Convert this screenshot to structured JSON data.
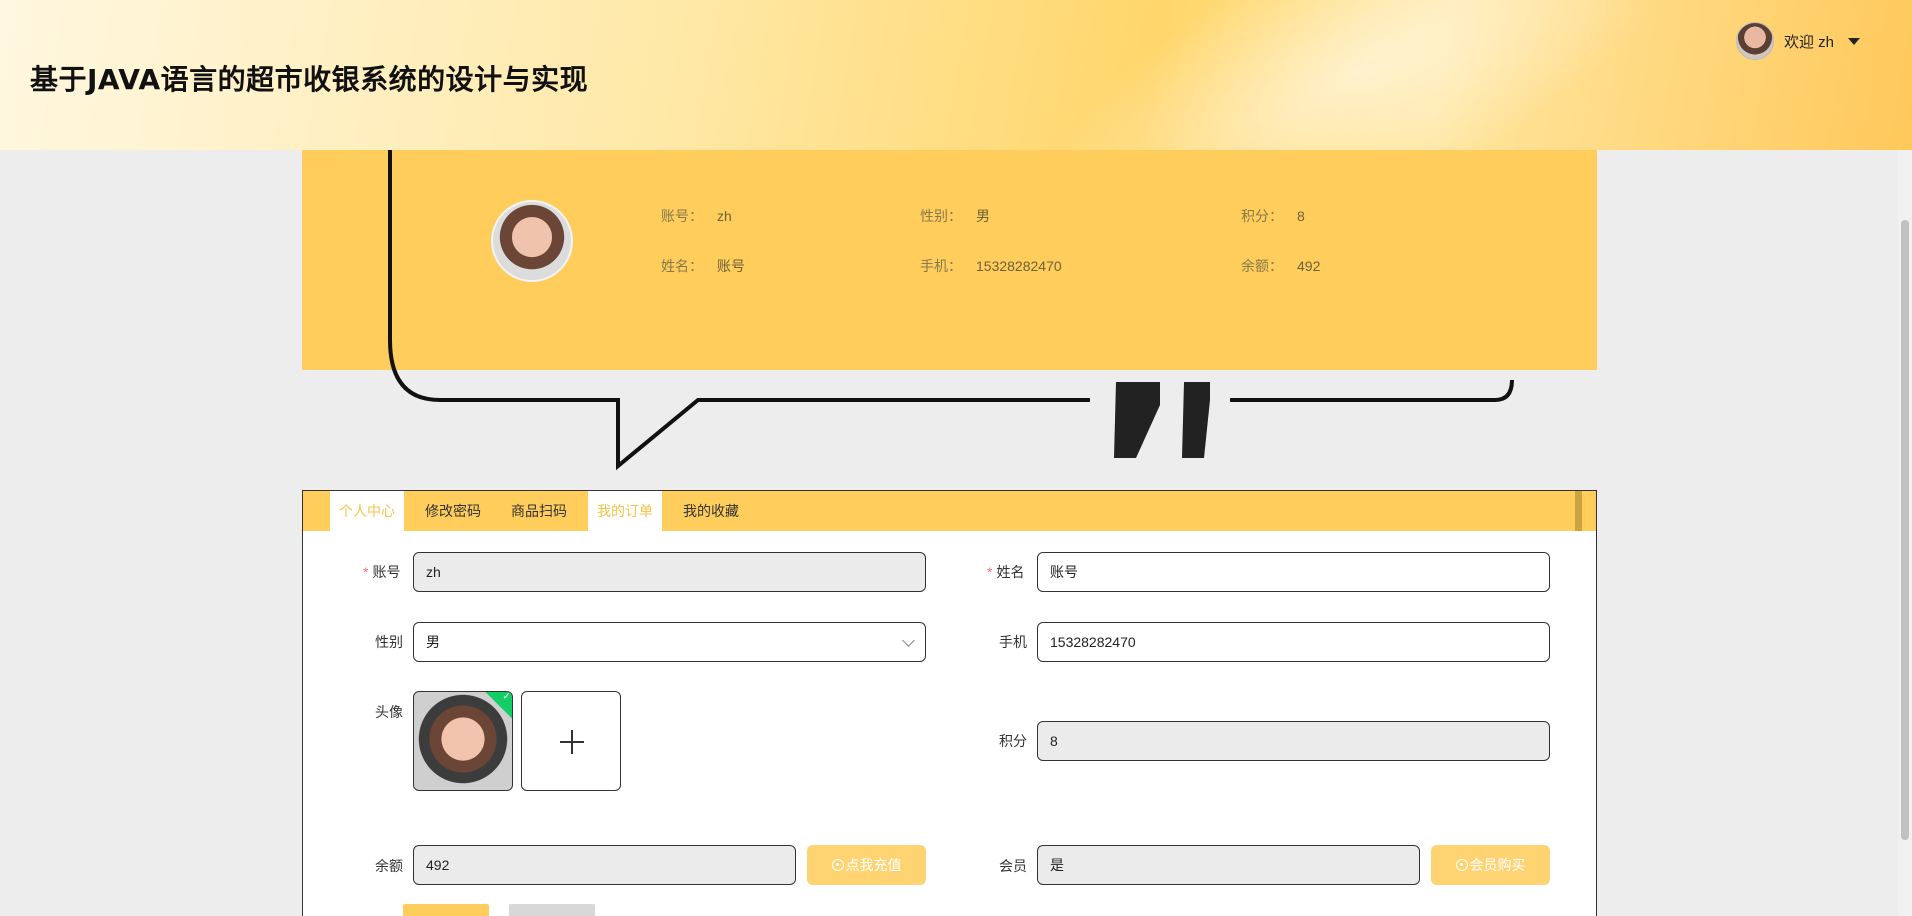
{
  "header": {
    "title": "基于JAVA语言的超市收银系统的设计与实现",
    "welcome": "欢迎 zh",
    "avatar_icon": "user-avatar"
  },
  "profile_card": {
    "account_label": "账号：",
    "account_value": "zh",
    "gender_label": "性别：",
    "gender_value": "男",
    "points_label": "积分：",
    "points_value": "8",
    "name_label": "姓名：",
    "name_value": "账号",
    "phone_label": "手机：",
    "phone_value": "15328282470",
    "balance_label": "余额：",
    "balance_value": "492"
  },
  "tabs": [
    {
      "label": "个人中心",
      "active": true
    },
    {
      "label": "修改密码",
      "active": false
    },
    {
      "label": "商品扫码",
      "active": false
    },
    {
      "label": "我的订单",
      "active": true
    },
    {
      "label": "我的收藏",
      "active": false
    }
  ],
  "form": {
    "account": {
      "label": "账号",
      "value": "zh",
      "required": true
    },
    "name": {
      "label": "姓名",
      "value": "账号",
      "required": true
    },
    "gender": {
      "label": "性别",
      "value": "男"
    },
    "phone": {
      "label": "手机",
      "value": "15328282470"
    },
    "avatar": {
      "label": "头像"
    },
    "points": {
      "label": "积分",
      "value": "8"
    },
    "balance": {
      "label": "余额",
      "value": "492",
      "button": "点我充值"
    },
    "member": {
      "label": "会员",
      "value": "是",
      "button": "会员购买"
    }
  },
  "colors": {
    "accent": "#fecd5b",
    "button": "#fed372",
    "active_tab_text": "#f5c34a",
    "success": "#13ce66"
  }
}
